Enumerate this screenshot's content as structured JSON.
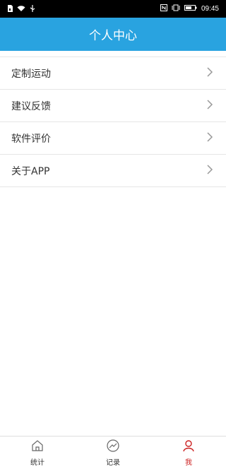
{
  "status_bar": {
    "time": "09:45",
    "icons_left": [
      "sim-icon",
      "wifi-icon",
      "usb-icon"
    ],
    "icons_right": [
      "nfc-icon",
      "vibrate-icon",
      "battery-icon"
    ]
  },
  "header": {
    "title": "个人中心",
    "background": "#29a3e0"
  },
  "menu": {
    "items": [
      {
        "label": "定制运动"
      },
      {
        "label": "建议反馈"
      },
      {
        "label": "软件评价"
      },
      {
        "label": "关于APP"
      }
    ]
  },
  "tabbar": {
    "tabs": [
      {
        "label": "统计",
        "icon": "home-icon"
      },
      {
        "label": "记录",
        "icon": "trend-icon"
      },
      {
        "label": "我",
        "icon": "user-icon"
      }
    ],
    "active_index": 2,
    "active_color": "#cc1f1f"
  }
}
